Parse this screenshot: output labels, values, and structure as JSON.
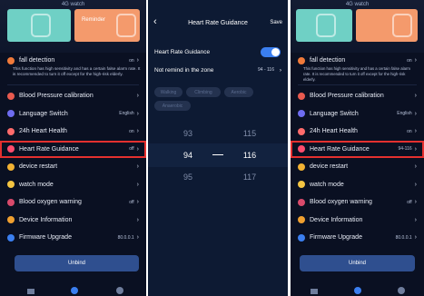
{
  "watch_title": "4G watch",
  "cards": {
    "reminder_label": "Reminder"
  },
  "fall": {
    "label": "fall detection",
    "value": "on",
    "description": "This function has high sensitivity and has a certain false alarm rate. It is recommended to turn it off except for the high-risk elderly."
  },
  "settings_left": [
    {
      "label": "Blood Pressure calibration",
      "value": "",
      "icon": "blood-pressure-icon",
      "color": "#e85a4f"
    },
    {
      "label": "Language Switch",
      "value": "English",
      "icon": "language-icon",
      "color": "#6e6cf0"
    },
    {
      "label": "24h Heart Health",
      "value": "on",
      "icon": "heart-health-icon",
      "color": "#ff6b6b"
    },
    {
      "label": "Heart Rate Guidance",
      "value": "off",
      "icon": "heart-rate-icon",
      "color": "#ff4d6d"
    },
    {
      "label": "device restart",
      "value": "",
      "icon": "restart-icon",
      "color": "#f2b233"
    },
    {
      "label": "watch mode",
      "value": "",
      "icon": "watch-mode-icon",
      "color": "#f5c542"
    },
    {
      "label": "Blood oxygen warning",
      "value": "off",
      "icon": "oxygen-icon",
      "color": "#d94a6b"
    },
    {
      "label": "Device Information",
      "value": "",
      "icon": "info-icon",
      "color": "#f0a030"
    },
    {
      "label": "Firmware Upgrade",
      "value": "80.0.0.1",
      "icon": "upgrade-icon",
      "color": "#3b7ff0"
    }
  ],
  "settings_right": [
    {
      "label": "Blood Pressure calibration",
      "value": ""
    },
    {
      "label": "Language Switch",
      "value": "English"
    },
    {
      "label": "24h Heart Health",
      "value": "on"
    },
    {
      "label": "Heart Rate Guidance",
      "value": "94-116"
    },
    {
      "label": "device restart",
      "value": ""
    },
    {
      "label": "watch mode",
      "value": ""
    },
    {
      "label": "Blood oxygen warning",
      "value": "off"
    },
    {
      "label": "Device Information",
      "value": ""
    },
    {
      "label": "Firmware Upgrade",
      "value": "80.0.0.1"
    }
  ],
  "unbind_label": "Unbind",
  "guidance": {
    "title": "Heart Rate Guidance",
    "save_label": "Save",
    "toggle_label": "Heart Rate Guidance",
    "toggle_on": true,
    "remind_label": "Not remind in the zone",
    "remind_value": "94 - 116",
    "chips": [
      "Walking",
      "Climbing",
      "Aerobic",
      "Anaerobic"
    ],
    "picker": {
      "left": [
        "93",
        "94",
        "95"
      ],
      "right": [
        "115",
        "116",
        "117"
      ],
      "separator": "—"
    }
  },
  "colors": {
    "highlight": "#e4302f",
    "accent": "#3b7ff0"
  }
}
